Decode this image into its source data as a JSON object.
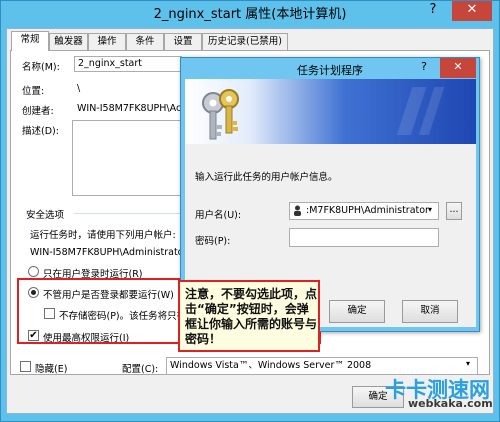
{
  "window": {
    "title": "2_nginx_start 属性(本地计算机)",
    "help": "?",
    "close": "✕"
  },
  "tabs": [
    "常规",
    "触发器",
    "操作",
    "条件",
    "设置",
    "历史记录(已禁用)"
  ],
  "general": {
    "name_label": "名称(M):",
    "name_value": "2_nginx_start",
    "location_label": "位置:",
    "location_value": "\\",
    "author_label": "创建者:",
    "author_value": "WIN-I58M7FK8UPH\\Ac",
    "description_label": "描述(D):"
  },
  "security": {
    "group_label": "安全选项",
    "run_as_label": "运行任务时，请使用下列用户帐户:",
    "account_value": "WIN-I58M7FK8UPH\\Administrato",
    "radio_logged_on": "只在用户登录时运行(R)",
    "radio_whether": "不管用户是否登录都要运行(W)",
    "dont_store_password": "不存储密码(P)。该任务将只有",
    "highest_privileges": "使用最高权限运行(I)",
    "highest_checked": true
  },
  "bottom": {
    "hidden_label": "隐藏(E)",
    "configure_label": "配置(C):",
    "configure_value": "Windows Vista™、Windows Server™ 2008",
    "ok_button": "确定"
  },
  "dialog": {
    "title": "任务计划程序",
    "help": "?",
    "close": "✕",
    "prompt": "输入运行此任务的用户帐户信息。",
    "username_label": "用户名(U):",
    "username_value": ":M7FK8UPH\\Administrator",
    "browse_button": "...",
    "password_label": "密码(P):",
    "ok_button": "确定",
    "cancel_button": "取消"
  },
  "annotation": {
    "text": "注意，不要勾选此项，点击“确定”按钮时，会弹框让你输入所需的账号与密码！"
  },
  "watermark": {
    "line1": "卡卡测速网",
    "line2": "webkaka.com"
  },
  "colors": {
    "titlebar": "#5ec1ec",
    "annotation_border": "#e02020",
    "annotation_bg": "#fffde0",
    "banner_dark": "#1f47b2",
    "watermark": "#2aa0e0"
  }
}
